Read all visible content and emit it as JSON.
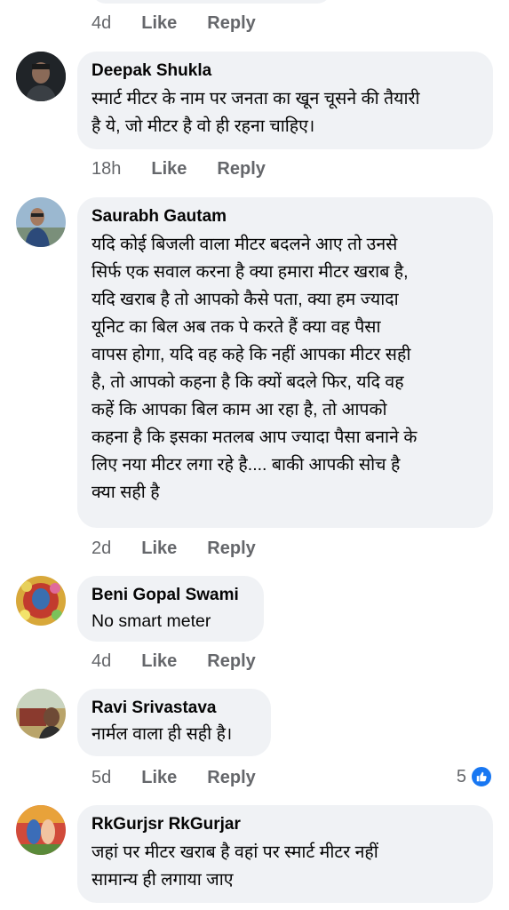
{
  "colors": {
    "bubble_bg": "#f0f2f5",
    "meta_text": "#65676b",
    "like_blue": "#1877f2"
  },
  "top_actions": {
    "time": "4d",
    "like": "Like",
    "reply": "Reply"
  },
  "comments": [
    {
      "author": "Deepak Shukla",
      "text": "स्मार्ट मीटर के नाम पर जनता का खून चूसने की तैयारी\nहै ये, जो मीटर है वो ही रहना चाहिए।",
      "time": "18h",
      "like": "Like",
      "reply": "Reply"
    },
    {
      "author": "Saurabh Gautam",
      "text": "यदि कोई बिजली वाला मीटर बदलने आए तो उनसे\nसिर्फ एक सवाल करना है क्या हमारा मीटर खराब है,\nयदि खराब है तो आपको कैसे पता, क्या हम ज्यादा\nयूनिट का बिल अब तक पे करते हैं क्या वह पैसा\nवापस होगा, यदि वह कहे कि नहीं आपका मीटर सही\nहै, तो आपको कहना है कि क्यों बदले फिर, यदि वह\nकहें कि आपका बिल काम आ रहा है, तो आपको\nकहना है कि इसका मतलब आप ज्यादा पैसा बनाने के\nलिए नया मीटर लगा रहे है.... बाकी आपकी सोच है\nक्या सही है",
      "time": "2d",
      "like": "Like",
      "reply": "Reply"
    },
    {
      "author": "Beni Gopal Swami",
      "text": "No smart meter",
      "time": "4d",
      "like": "Like",
      "reply": "Reply"
    },
    {
      "author": "Ravi Srivastava",
      "text": "नार्मल वाला ही सही है।",
      "time": "5d",
      "like": "Like",
      "reply": "Reply",
      "reaction_count": "5",
      "reaction_icon": "like-thumb-icon"
    },
    {
      "author": "RkGurjsr RkGurjar",
      "text": "जहां पर मीटर खराब है वहां पर स्मार्ट मीटर नहीं\nसामान्य  ही लगाया जाए"
    }
  ]
}
